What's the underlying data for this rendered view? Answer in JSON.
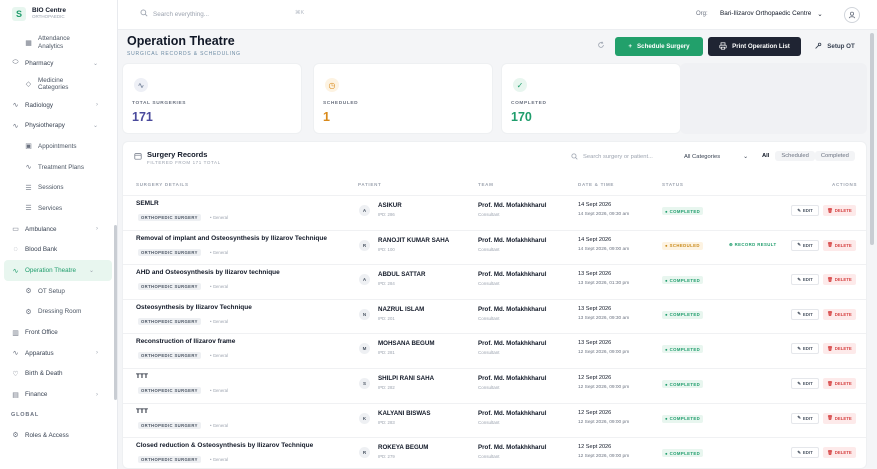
{
  "brand": {
    "name": "BIO Centre",
    "subtitle": "ORTHOPAEDIC"
  },
  "sidebar": {
    "items": [
      {
        "label": "Attendance",
        "label2": "Analytics",
        "sub": true,
        "icon": "chart-icon"
      },
      {
        "label": "Pharmacy",
        "sub": false,
        "icon": "pill-icon",
        "chevron": "⌄"
      },
      {
        "label": "Medicine",
        "label2": "Categories",
        "sub": true,
        "icon": "tag-icon"
      },
      {
        "label": "Radiology",
        "sub": false,
        "icon": "pulse-icon",
        "chevron": "›"
      },
      {
        "label": "Physiotherapy",
        "sub": false,
        "icon": "pulse-icon",
        "chevron": "⌄"
      },
      {
        "label": "Appointments",
        "sub": true,
        "icon": "calendar-icon"
      },
      {
        "label": "Treatment Plans",
        "sub": true,
        "icon": "pulse-icon"
      },
      {
        "label": "Sessions",
        "sub": true,
        "icon": "list-icon"
      },
      {
        "label": "Services",
        "sub": true,
        "icon": "list-icon"
      },
      {
        "label": "Ambulance",
        "sub": false,
        "icon": "truck-icon",
        "chevron": "›"
      },
      {
        "label": "Blood Bank",
        "sub": false,
        "icon": "drop-icon"
      },
      {
        "label": "Operation Theatre",
        "sub": false,
        "icon": "pulse-icon",
        "chevron": "⌄",
        "active": true
      },
      {
        "label": "OT Setup",
        "sub": true,
        "icon": "gear-icon"
      },
      {
        "label": "Dressing Room",
        "sub": true,
        "icon": "gear-icon"
      },
      {
        "label": "Front Office",
        "sub": false,
        "icon": "building-icon"
      },
      {
        "label": "Apparatus",
        "sub": false,
        "icon": "pulse-icon",
        "chevron": "›"
      },
      {
        "label": "Birth & Death",
        "sub": false,
        "icon": "heart-icon"
      },
      {
        "label": "Finance",
        "sub": false,
        "icon": "wallet-icon",
        "chevron": "›"
      }
    ],
    "section_global": "GLOBAL",
    "global_items": [
      {
        "label": "Roles & Access",
        "icon": "gear-icon"
      }
    ]
  },
  "topbar": {
    "search_placeholder": "Search everything...",
    "search_kbd": "⌘K",
    "org_label": "Org:",
    "org_value": "Bari-Ilizarov Orthopaedic Centre"
  },
  "page": {
    "title": "Operation Theatre",
    "subtitle": "SURGICAL RECORDS & SCHEDULING",
    "btn_schedule": "Schedule Surgery",
    "btn_print": "Print Operation List",
    "btn_setup": "Setup OT"
  },
  "stats": [
    {
      "label": "TOTAL SURGERIES",
      "value": "171",
      "color": "#4a4a9c",
      "icon_bg": "#eef0f6",
      "icon_color": "#5b6b86",
      "icon": "pulse-icon"
    },
    {
      "label": "SCHEDULED",
      "value": "1",
      "color": "#d98a1b",
      "icon_bg": "#fdf3e2",
      "icon_color": "#d98a1b",
      "icon": "clock-icon"
    },
    {
      "label": "COMPLETED",
      "value": "170",
      "color": "#1f9d6c",
      "icon_bg": "#e8f6ef",
      "icon_color": "#1f9d6c",
      "icon": "check-icon"
    }
  ],
  "records": {
    "title": "Surgery Records",
    "subtitle": "FILTERED FROM 171 TOTAL",
    "search_placeholder": "Search surgery or patient...",
    "category": "All Categories",
    "tabs": [
      "All",
      "Scheduled",
      "Completed"
    ],
    "columns": [
      "SURGERY DETAILS",
      "PATIENT",
      "TEAM",
      "DATE & TIME",
      "STATUS",
      "ACTIONS"
    ],
    "edit_label": "EDIT",
    "delete_label": "DELETE",
    "record_label": "RECORD RESULT",
    "rows": [
      {
        "procedure": "SEMLR",
        "tag": "ORTHOPEDIC SURGERY",
        "type": "• General",
        "initial": "A",
        "patient": "ASIKUR",
        "pid": "IPD: 286",
        "doctor": "Prof. Md. Mofakhkharul",
        "role": "Consultant",
        "date": "14 Sept 2026",
        "time": "14 Sept 2026, 09:30 am",
        "status": "COMPLETED",
        "status_class": "completed",
        "record": ""
      },
      {
        "procedure": "Removal of implant and Osteosynthesis by Ilizarov Technique",
        "tag": "ORTHOPEDIC SURGERY",
        "type": "• General",
        "initial": "R",
        "patient": "RANOJIT KUMAR SAHA",
        "pid": "IPD: 100",
        "doctor": "Prof. Md. Mofakhkharul",
        "role": "Consultant",
        "date": "14 Sept 2026",
        "time": "14 Sept 2026, 09:00 am",
        "status": "SCHEDULED",
        "status_class": "scheduled",
        "record": "RECORD RESULT"
      },
      {
        "procedure": "AHD and Osteosynthesis by Ilizarov technique",
        "tag": "ORTHOPEDIC SURGERY",
        "type": "• General",
        "initial": "A",
        "patient": "ABDUL SATTAR",
        "pid": "IPD: 284",
        "doctor": "Prof. Md. Mofakhkharul",
        "role": "Consultant",
        "date": "13 Sept 2026",
        "time": "13 Sept 2026, 01:30 pm",
        "status": "COMPLETED",
        "status_class": "completed",
        "record": ""
      },
      {
        "procedure": "Osteosynthesis by Ilizarov Technique",
        "tag": "ORTHOPEDIC SURGERY",
        "type": "• General",
        "initial": "N",
        "patient": "NAZRUL ISLAM",
        "pid": "IPD: 201",
        "doctor": "Prof. Md. Mofakhkharul",
        "role": "Consultant",
        "date": "13 Sept 2026",
        "time": "13 Sept 2026, 09:30 am",
        "status": "COMPLETED",
        "status_class": "completed",
        "record": ""
      },
      {
        "procedure": "Reconstruction of Ilizarov frame",
        "tag": "ORTHOPEDIC SURGERY",
        "type": "• General",
        "initial": "M",
        "patient": "MOHSANA BEGUM",
        "pid": "IPD: 281",
        "doctor": "Prof. Md. Mofakhkharul",
        "role": "Consultant",
        "date": "13 Sept 2026",
        "time": "12 Sept 2026, 09:00 pm",
        "status": "COMPLETED",
        "status_class": "completed",
        "record": ""
      },
      {
        "procedure": "TTT",
        "tag": "ORTHOPEDIC SURGERY",
        "type": "• General",
        "initial": "S",
        "patient": "SHILPI RANI SAHA",
        "pid": "IPD: 282",
        "doctor": "Prof. Md. Mofakhkharul",
        "role": "Consultant",
        "date": "12 Sept 2026",
        "time": "12 Sept 2026, 09:00 pm",
        "status": "COMPLETED",
        "status_class": "completed",
        "record": ""
      },
      {
        "procedure": "TTT",
        "tag": "ORTHOPEDIC SURGERY",
        "type": "• General",
        "initial": "K",
        "patient": "KALYANI BISWAS",
        "pid": "IPD: 283",
        "doctor": "Prof. Md. Mofakhkharul",
        "role": "Consultant",
        "date": "12 Sept 2026",
        "time": "12 Sept 2026, 09:00 pm",
        "status": "COMPLETED",
        "status_class": "completed",
        "record": ""
      },
      {
        "procedure": "Closed reduction & Osteosynthesis by Ilizarov Technique",
        "tag": "ORTHOPEDIC SURGERY",
        "type": "• General",
        "initial": "R",
        "patient": "ROKEYA BEGUM",
        "pid": "IPD: 279",
        "doctor": "Prof. Md. Mofakhkharul",
        "role": "Consultant",
        "date": "12 Sept 2026",
        "time": "12 Sept 2026, 09:00 pm",
        "status": "COMPLETED",
        "status_class": "completed",
        "record": ""
      }
    ]
  }
}
